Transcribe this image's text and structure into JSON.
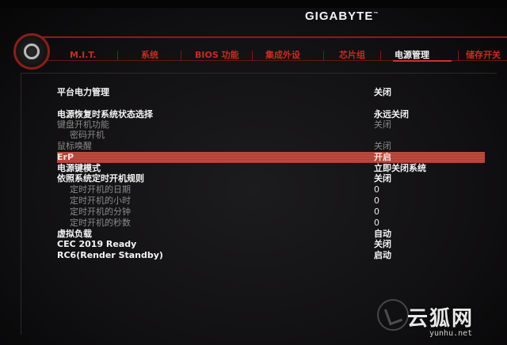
{
  "brand": {
    "name": "GIGABYTE",
    "mark": "™"
  },
  "tabs": [
    {
      "label": "M.I.T."
    },
    {
      "label": "系统"
    },
    {
      "label": "BIOS 功能"
    },
    {
      "label": "集成外设"
    },
    {
      "label": "芯片组"
    },
    {
      "label": "电源管理"
    },
    {
      "label": "储存开关"
    }
  ],
  "active_tab": "电源管理",
  "settings": [
    {
      "label": "平台电力管理",
      "value": "关闭"
    },
    {
      "label": "电源恢复时系统状态选择",
      "value": "永远关闭"
    },
    {
      "label": "键盘开机功能",
      "value": "关闭"
    },
    {
      "label": "密码开机",
      "value": ""
    },
    {
      "label": "鼠标唤醒",
      "value": "关闭"
    },
    {
      "label": "ErP",
      "value": "开启"
    },
    {
      "label": "电源键模式",
      "value": "立即关闭系统"
    },
    {
      "label": "依照系统定时开机规则",
      "value": "关闭"
    },
    {
      "label": "定时开机的日期",
      "value": "0"
    },
    {
      "label": "定时开机的小时",
      "value": "0"
    },
    {
      "label": "定时开机的分钟",
      "value": "0"
    },
    {
      "label": "定时开机的秒数",
      "value": "0"
    },
    {
      "label": "虚拟负载",
      "value": "自动"
    },
    {
      "label": "CEC 2019 Ready",
      "value": "关闭"
    },
    {
      "label": "RC6(Render Standby)",
      "value": "启动"
    }
  ],
  "watermark": {
    "text": "云狐网",
    "url": "yunhu.net"
  }
}
